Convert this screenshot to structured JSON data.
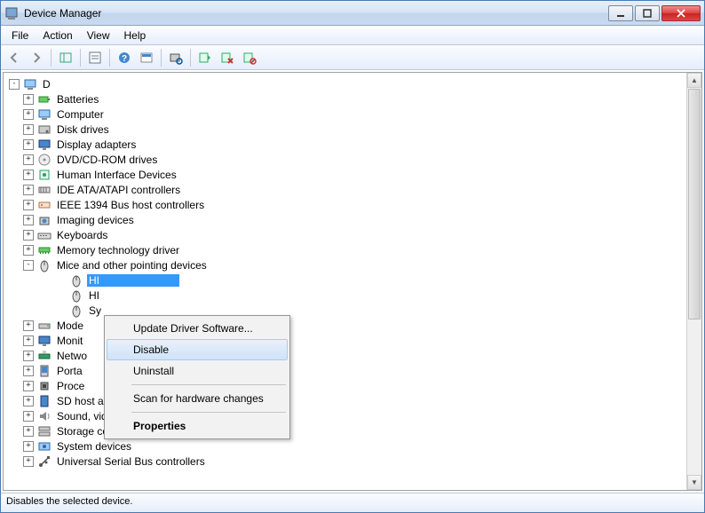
{
  "window": {
    "title": "Device Manager"
  },
  "menubar": [
    "File",
    "Action",
    "View",
    "Help"
  ],
  "tree": {
    "root": "D",
    "categories": [
      {
        "label": "Batteries",
        "icon": "battery"
      },
      {
        "label": "Computer",
        "icon": "computer"
      },
      {
        "label": "Disk drives",
        "icon": "disk"
      },
      {
        "label": "Display adapters",
        "icon": "display"
      },
      {
        "label": "DVD/CD-ROM drives",
        "icon": "cd"
      },
      {
        "label": "Human Interface Devices",
        "icon": "hid"
      },
      {
        "label": "IDE ATA/ATAPI controllers",
        "icon": "ide"
      },
      {
        "label": "IEEE 1394 Bus host controllers",
        "icon": "1394"
      },
      {
        "label": "Imaging devices",
        "icon": "camera"
      },
      {
        "label": "Keyboards",
        "icon": "keyboard"
      },
      {
        "label": "Memory technology driver",
        "icon": "memory"
      },
      {
        "label": "Mice and other pointing devices",
        "icon": "mouse",
        "expanded": true,
        "children": [
          {
            "label": "HI",
            "icon": "mouse",
            "selected": true,
            "truncated": true
          },
          {
            "label": "HI",
            "icon": "mouse",
            "truncated": true
          },
          {
            "label": "Sy",
            "icon": "mouse",
            "truncated": true
          }
        ]
      },
      {
        "label": "Mode",
        "icon": "modem",
        "truncated": true
      },
      {
        "label": "Monit",
        "icon": "monitor",
        "truncated": true
      },
      {
        "label": "Netwo",
        "icon": "network",
        "truncated": true
      },
      {
        "label": "Porta",
        "icon": "portable",
        "truncated": true
      },
      {
        "label": "Proce",
        "icon": "cpu",
        "truncated": true
      },
      {
        "label": "SD host adapters",
        "icon": "sd"
      },
      {
        "label": "Sound, video and game controllers",
        "icon": "sound"
      },
      {
        "label": "Storage controllers",
        "icon": "storage"
      },
      {
        "label": "System devices",
        "icon": "system"
      },
      {
        "label": "Universal Serial Bus controllers",
        "icon": "usb"
      }
    ]
  },
  "context_menu": {
    "items": [
      {
        "label": "Update Driver Software..."
      },
      {
        "label": "Disable",
        "hover": true
      },
      {
        "label": "Uninstall"
      },
      {
        "sep": true
      },
      {
        "label": "Scan for hardware changes"
      },
      {
        "sep": true
      },
      {
        "label": "Properties",
        "bold": true
      }
    ]
  },
  "statusbar": {
    "text": "Disables the selected device."
  }
}
